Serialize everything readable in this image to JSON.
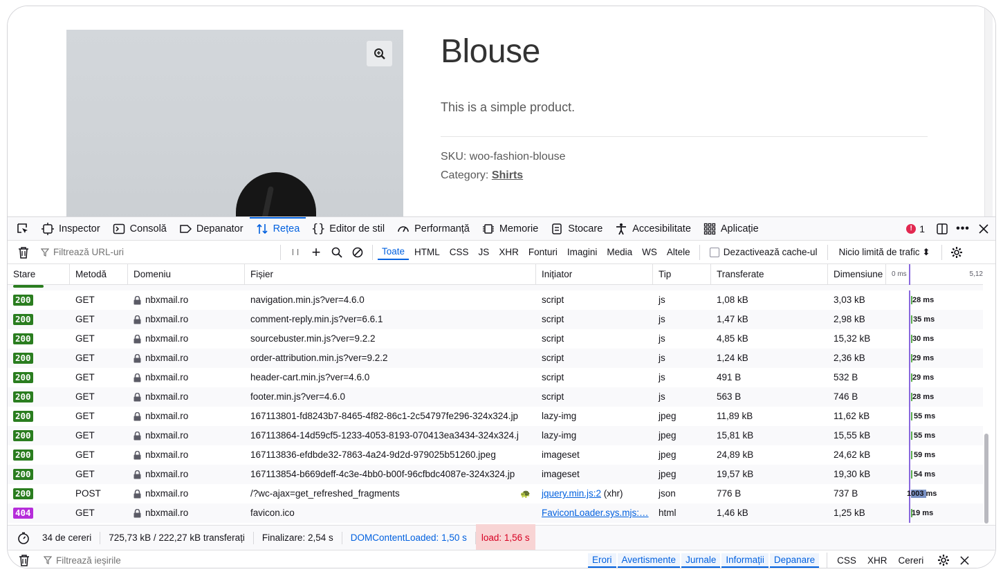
{
  "product": {
    "title": "Blouse",
    "description": "This is a simple product.",
    "sku": "SKU: woo-fashion-blouse",
    "category_label": "Category:",
    "category_link": "Shirts"
  },
  "devtools": {
    "tabs": [
      {
        "label": "Inspector",
        "icon": "inspector-icon"
      },
      {
        "label": "Consolă",
        "icon": "console-icon"
      },
      {
        "label": "Depanator",
        "icon": "debugger-icon"
      },
      {
        "label": "Rețea",
        "icon": "network-icon",
        "active": true
      },
      {
        "label": "Editor de stil",
        "icon": "style-editor-icon"
      },
      {
        "label": "Performanță",
        "icon": "performance-icon"
      },
      {
        "label": "Memorie",
        "icon": "memory-icon"
      },
      {
        "label": "Stocare",
        "icon": "storage-icon"
      },
      {
        "label": "Accesibilitate",
        "icon": "accessibility-icon"
      },
      {
        "label": "Aplicație",
        "icon": "application-icon"
      }
    ],
    "error_count": "1",
    "toolbar": {
      "filter_placeholder": "Filtrează URL-uri",
      "pause_label": "I I",
      "type_filters": [
        "Toate",
        "HTML",
        "CSS",
        "JS",
        "XHR",
        "Fonturi",
        "Imagini",
        "Media",
        "WS",
        "Altele"
      ],
      "active_filter": "Toate",
      "disable_cache_label": "Dezactivează cache-ul",
      "throttle_label": "Nicio limită de trafic ⬍"
    },
    "columns": {
      "status": "Stare",
      "method": "Metodă",
      "domain": "Domeniu",
      "file": "Fișier",
      "initiator": "Inițiator",
      "type": "Tip",
      "transferred": "Transferate",
      "size": "Dimensiune",
      "wf_start": "0 ms",
      "wf_end": "5,12"
    },
    "requests": [
      {
        "status": "200",
        "method": "GET",
        "domain": "nbxmail.ro",
        "file": "navigation.min.js?ver=4.6.0",
        "initiator": "script",
        "initiator_extra": "",
        "type": "js",
        "transferred": "1,08 kB",
        "size": "3,03 kB",
        "time": "28 ms",
        "ms": 28
      },
      {
        "status": "200",
        "method": "GET",
        "domain": "nbxmail.ro",
        "file": "comment-reply.min.js?ver=6.6.1",
        "initiator": "script",
        "initiator_extra": "",
        "type": "js",
        "transferred": "1,47 kB",
        "size": "2,98 kB",
        "time": "35 ms",
        "ms": 35
      },
      {
        "status": "200",
        "method": "GET",
        "domain": "nbxmail.ro",
        "file": "sourcebuster.min.js?ver=9.2.2",
        "initiator": "script",
        "initiator_extra": "",
        "type": "js",
        "transferred": "4,85 kB",
        "size": "15,32 kB",
        "time": "30 ms",
        "ms": 30
      },
      {
        "status": "200",
        "method": "GET",
        "domain": "nbxmail.ro",
        "file": "order-attribution.min.js?ver=9.2.2",
        "initiator": "script",
        "initiator_extra": "",
        "type": "js",
        "transferred": "1,24 kB",
        "size": "2,36 kB",
        "time": "29 ms",
        "ms": 29
      },
      {
        "status": "200",
        "method": "GET",
        "domain": "nbxmail.ro",
        "file": "header-cart.min.js?ver=4.6.0",
        "initiator": "script",
        "initiator_extra": "",
        "type": "js",
        "transferred": "491 B",
        "size": "532 B",
        "time": "29 ms",
        "ms": 29
      },
      {
        "status": "200",
        "method": "GET",
        "domain": "nbxmail.ro",
        "file": "footer.min.js?ver=4.6.0",
        "initiator": "script",
        "initiator_extra": "",
        "type": "js",
        "transferred": "563 B",
        "size": "746 B",
        "time": "28 ms",
        "ms": 28
      },
      {
        "status": "200",
        "method": "GET",
        "domain": "nbxmail.ro",
        "file": "167113801-fd8243b7-8465-4f82-86c1-2c54797fe296-324x324.jp",
        "initiator": "lazy-img",
        "initiator_extra": "",
        "type": "jpeg",
        "transferred": "11,89 kB",
        "size": "11,62 kB",
        "time": "55 ms",
        "ms": 55
      },
      {
        "status": "200",
        "method": "GET",
        "domain": "nbxmail.ro",
        "file": "167113864-14d59cf5-1233-4053-8193-070413ea3434-324x324.j",
        "initiator": "lazy-img",
        "initiator_extra": "",
        "type": "jpeg",
        "transferred": "15,81 kB",
        "size": "15,55 kB",
        "time": "55 ms",
        "ms": 55
      },
      {
        "status": "200",
        "method": "GET",
        "domain": "nbxmail.ro",
        "file": "167113836-efdbde32-7863-4a24-9d2d-979025b51260.jpeg",
        "initiator": "imageset",
        "initiator_extra": "",
        "type": "jpeg",
        "transferred": "24,89 kB",
        "size": "24,62 kB",
        "time": "59 ms",
        "ms": 59
      },
      {
        "status": "200",
        "method": "GET",
        "domain": "nbxmail.ro",
        "file": "167113854-b669deff-4c3e-4bb0-b00f-96cfbdc4087e-324x324.jp",
        "initiator": "imageset",
        "initiator_extra": "",
        "type": "jpeg",
        "transferred": "19,57 kB",
        "size": "19,30 kB",
        "time": "54 ms",
        "ms": 54
      },
      {
        "status": "200",
        "method": "POST",
        "domain": "nbxmail.ro",
        "file": "/?wc-ajax=get_refreshed_fragments",
        "initiator": "jquery.min.js:2",
        "initiator_extra": "(xhr)",
        "type": "json",
        "transferred": "776 B",
        "size": "737 B",
        "time": "1003 ms",
        "ms": 1003
      },
      {
        "status": "404",
        "method": "GET",
        "domain": "nbxmail.ro",
        "file": "favicon.ico",
        "initiator": "FaviconLoader.sys.mjs:…",
        "initiator_extra": "",
        "type": "html",
        "transferred": "1,46 kB",
        "size": "1,25 kB",
        "time": "19 ms",
        "ms": 19
      }
    ],
    "summary": {
      "requests": "34 de cereri",
      "transferred": "725,73 kB / 222,27 kB transferați",
      "finish": "Finalizare: 2,54 s",
      "dcl": "DOMContentLoaded: 1,50 s",
      "load": "load: 1,56 s"
    },
    "console": {
      "filter_placeholder": "Filtrează ieșirile",
      "tabs": [
        "Erori",
        "Avertismente",
        "Jurnale",
        "Informații",
        "Depanare"
      ],
      "plain": [
        "CSS",
        "XHR",
        "Cereri"
      ]
    }
  }
}
